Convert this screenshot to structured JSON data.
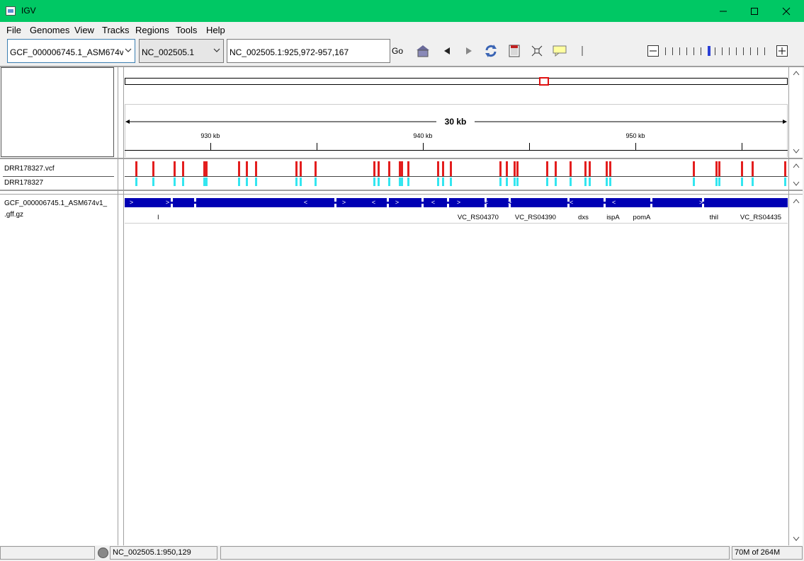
{
  "window": {
    "title": "IGV",
    "controls": [
      "minimize-icon",
      "maximize-icon",
      "close-icon"
    ]
  },
  "menu": {
    "items": [
      "File",
      "Genomes",
      "View",
      "Tracks",
      "Regions",
      "Tools",
      "Help"
    ]
  },
  "toolbar": {
    "genome": "GCF_000006745.1_ASM674v1_...",
    "chromosome": "NC_002505.1",
    "locus": "NC_002505.1:925,972-957,167",
    "go_label": "Go",
    "icons": [
      "home-icon",
      "back-icon",
      "forward-icon",
      "refresh-icon",
      "region-of-interest-icon",
      "fit-to-window-icon",
      "popup-info-icon",
      "ruler-divider-icon"
    ],
    "zoom": {
      "out_label": "minus-icon",
      "in_label": "plus-icon",
      "ticks": 15,
      "current_level": 7
    }
  },
  "ruler": {
    "span_label": "30 kb",
    "ticks": [
      "930 kb",
      "940 kb",
      "950 kb"
    ],
    "view_start_bp": 925972,
    "view_end_bp": 957167,
    "chrom_length_bp": 2961149
  },
  "tracks": {
    "variant_track": "DRR178327.vcf",
    "sample_track": "DRR178327",
    "annotation_track_line1": "GCF_000006745.1_ASM674v1_",
    "annotation_track_line2": ".gff.gz"
  },
  "variants": [
    926500,
    927300,
    928300,
    928700,
    929700,
    929800,
    931350,
    931700,
    932150,
    934050,
    934250,
    934950,
    937700,
    937900,
    938400,
    938900,
    939000,
    939300,
    940700,
    940950,
    941300,
    943650,
    943950,
    944300,
    944450,
    945850,
    946250,
    946950,
    947650,
    947850,
    948650,
    948800,
    952750,
    953800,
    953950,
    955000,
    955500,
    957050
  ],
  "genes": [
    {
      "label": "l",
      "pos": 927550
    },
    {
      "label": "VC_RS04370",
      "pos": 942600
    },
    {
      "label": "VC_RS04390",
      "pos": 945300
    },
    {
      "label": "dxs",
      "pos": 947550
    },
    {
      "label": "ispA",
      "pos": 948950
    },
    {
      "label": "pomA",
      "pos": 950300
    },
    {
      "label": "thiI",
      "pos": 953700
    },
    {
      "label": "VC_RS04435",
      "pos": 955900
    }
  ],
  "gene_strands": [
    {
      "strand": ">",
      "pos": 926300
    },
    {
      "strand": ">",
      "pos": 928000
    },
    {
      "strand": "<",
      "pos": 934500
    },
    {
      "strand": ">",
      "pos": 936300
    },
    {
      "strand": "<",
      "pos": 937700
    },
    {
      "strand": ">",
      "pos": 938800
    },
    {
      "strand": "<",
      "pos": 940500
    },
    {
      "strand": ">",
      "pos": 941700
    },
    {
      "strand": "<",
      "pos": 943000
    },
    {
      "strand": ">",
      "pos": 944100
    },
    {
      "strand": "<",
      "pos": 947000
    },
    {
      "strand": "<",
      "pos": 949000
    },
    {
      "strand": ">",
      "pos": 953100
    }
  ],
  "status": {
    "left": "",
    "position": "NC_002505.1:950,129",
    "message": "",
    "memory": "70M of 264M"
  },
  "colors": {
    "titlebar": "#00c864",
    "variant": "#e31e1e",
    "genotype": "#33e6f0",
    "gene": "#0000b4",
    "zoom_marker": "#2a3fd6"
  }
}
